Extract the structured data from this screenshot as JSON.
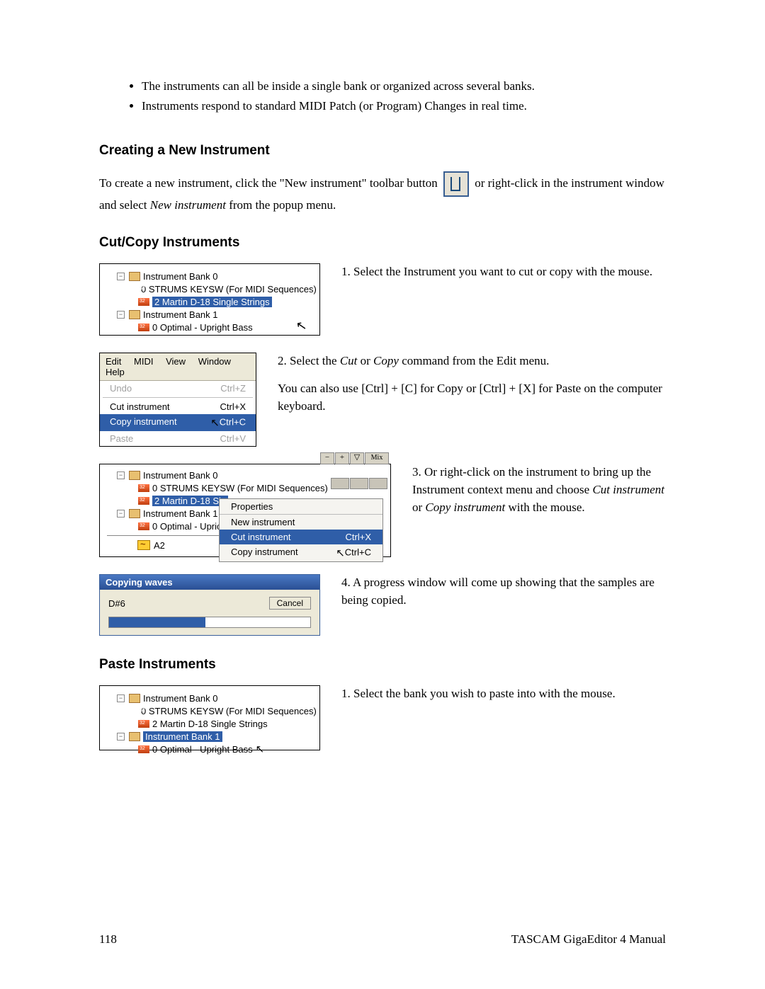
{
  "bullets": [
    "The instruments can all be inside a single bank or organized across several banks.",
    "Instruments respond to standard MIDI Patch (or Program) Changes in real time."
  ],
  "heading_create": "Creating a New Instrument",
  "create_text_a": "To create a new instrument, click the \"New instrument\" toolbar button ",
  "create_text_b": " or right-click in the instrument window and select ",
  "create_italic": "New instrument",
  "create_text_c": " from the popup menu.",
  "heading_cutcopy": "Cut/Copy Instruments",
  "step1": "1. Select the Instrument you want to cut or copy with the mouse.",
  "step2a": "2. Select the ",
  "step2_cut": "Cut",
  "step2b": " or ",
  "step2_copy": "Copy",
  "step2c": " command from the Edit menu.",
  "step2_extra": "You can also use [Ctrl] + [C] for Copy or [Ctrl] + [X] for Paste on the computer keyboard.",
  "step3a": "3. Or right-click on the instrument to bring up the Instrument context menu and choose ",
  "step3_cut": "Cut instrument",
  "step3b": " or ",
  "step3_copy": "Copy instrument",
  "step3c": " with the mouse.",
  "step4": "4. A progress window will come up showing that the samples are being copied.",
  "heading_paste": "Paste Instruments",
  "paste_step1": "1. Select the bank you wish to paste into with the mouse.",
  "tree": {
    "bank0": "Instrument Bank 0",
    "strums": "0 STRUMS KEYSW (For MIDI Sequences)",
    "martin": "2 Martin D-18 Single Strings",
    "bank1": "Instrument Bank 1",
    "optimal": "0 Optimal - Upright Bass",
    "optimal_trunc": "0 Optimal - Upric",
    "a2": "A2"
  },
  "menubar": {
    "edit": "Edit",
    "midi": "MIDI",
    "view": "View",
    "window": "Window",
    "help": "Help"
  },
  "editmenu": {
    "undo": "Undo",
    "undo_sc": "Ctrl+Z",
    "cut": "Cut instrument",
    "cut_sc": "Ctrl+X",
    "copy": "Copy instrument",
    "copy_sc": "Ctrl+C",
    "paste": "Paste",
    "paste_sc": "Ctrl+V"
  },
  "context": {
    "props": "Properties",
    "new": "New instrument",
    "cut": "Cut instrument",
    "cut_sc": "Ctrl+X",
    "copy": "Copy instrument",
    "copy_sc": "Ctrl+C"
  },
  "winbtns": {
    "minus": "−",
    "plus": "+",
    "tri": "▽",
    "mix": "Mix"
  },
  "dialog": {
    "title": "Copying waves",
    "note": "D#6",
    "cancel": "Cancel"
  },
  "footer": {
    "page": "118",
    "book": "TASCAM GigaEditor 4 Manual"
  }
}
